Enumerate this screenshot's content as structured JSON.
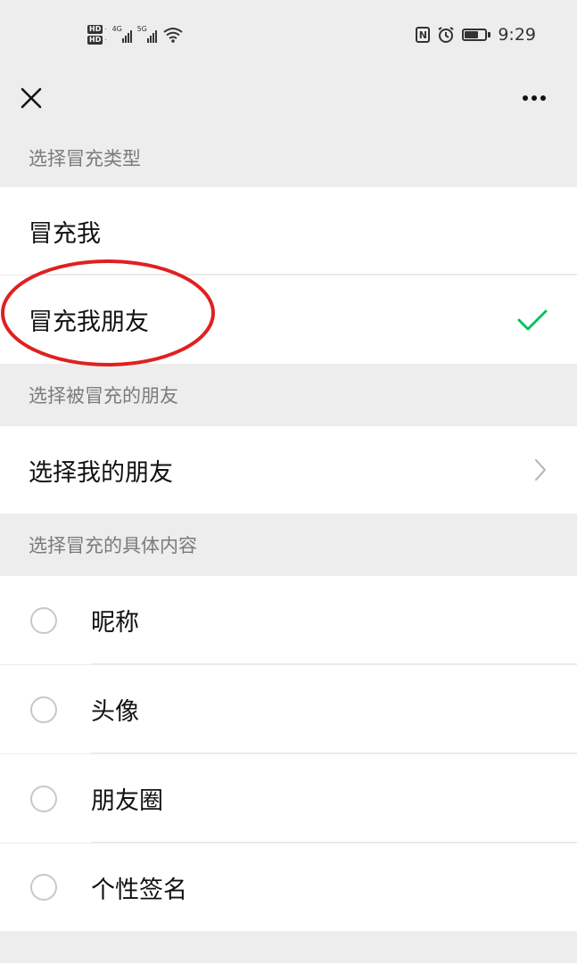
{
  "status_bar": {
    "network_1": "4G",
    "network_2": "5G",
    "hd_label": "HD",
    "time": "9:29",
    "battery_level": 0.7
  },
  "nav": {
    "close_icon": "close-icon",
    "more_icon": "more-icon"
  },
  "sections": {
    "type_header": "选择冒充类型",
    "friend_header": "选择被冒充的朋友",
    "content_header": "选择冒充的具体内容"
  },
  "type_options": [
    {
      "label": "冒充我",
      "selected": false
    },
    {
      "label": "冒充我朋友",
      "selected": true
    }
  ],
  "friend_row": {
    "label": "选择我的朋友"
  },
  "content_options": [
    {
      "label": "昵称",
      "checked": false
    },
    {
      "label": "头像",
      "checked": false
    },
    {
      "label": "朋友圈",
      "checked": false
    },
    {
      "label": "个性签名",
      "checked": false
    }
  ],
  "colors": {
    "accent_green": "#07c160",
    "annotation_red": "#e02020",
    "background": "#ededed"
  }
}
